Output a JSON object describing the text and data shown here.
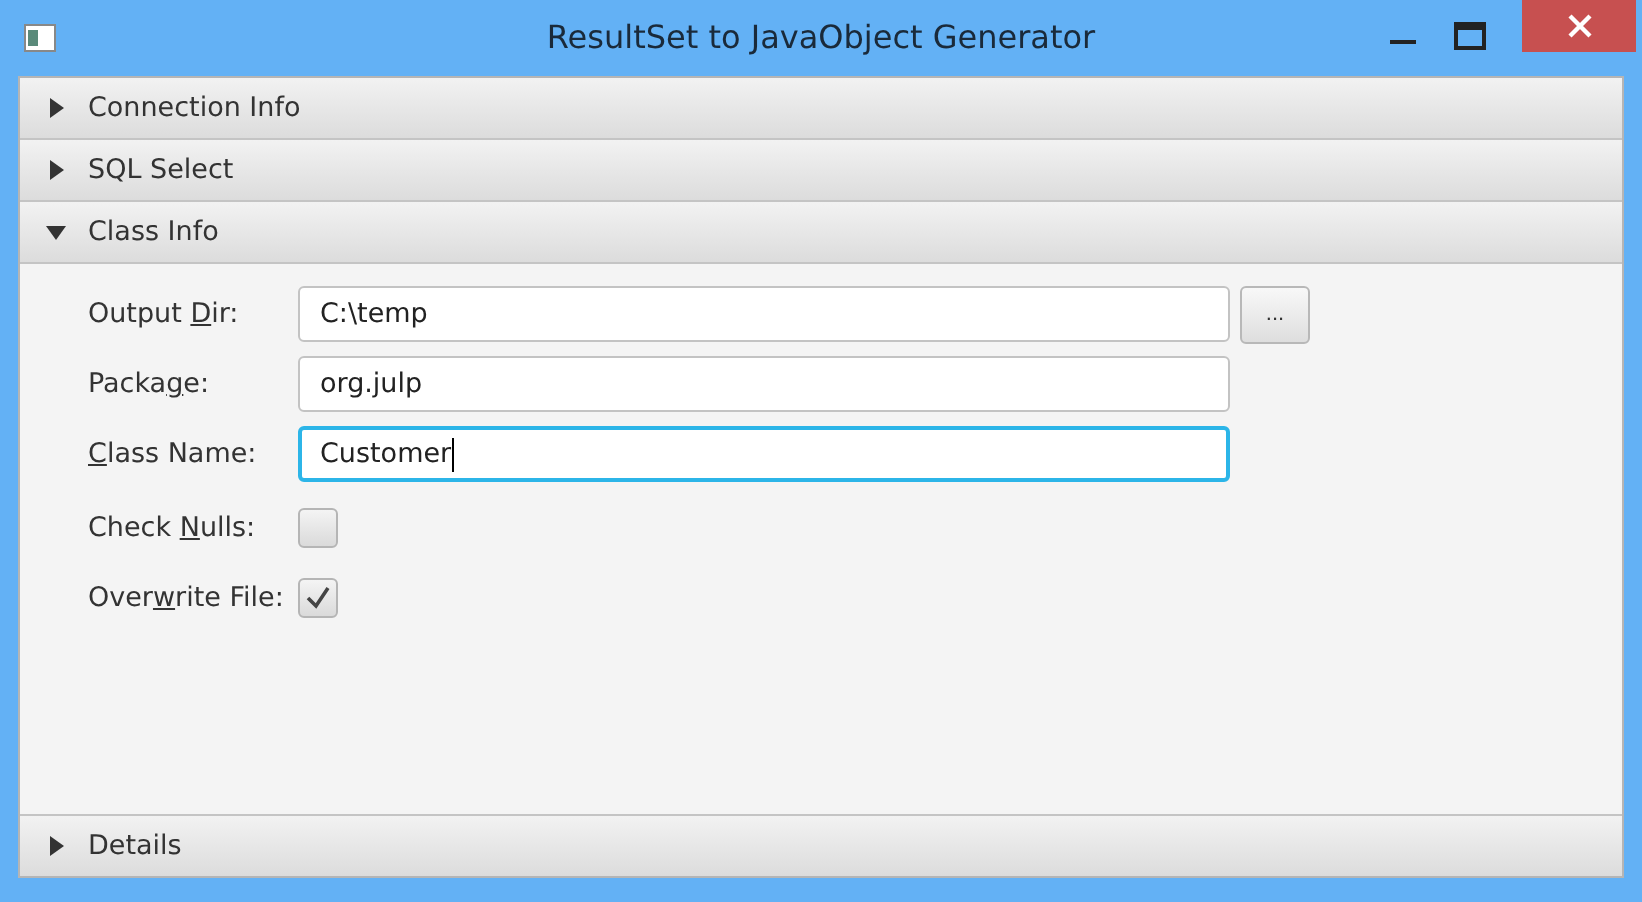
{
  "window": {
    "title": "ResultSet to JavaObject Generator"
  },
  "panes": [
    {
      "title": "Connection Info",
      "expanded": false
    },
    {
      "title": "SQL Select",
      "expanded": false
    },
    {
      "title": "Class Info",
      "expanded": true,
      "form": [
        {
          "kind": "text",
          "label": {
            "before": "Output ",
            "key": "D",
            "after": "ir:"
          },
          "value": "C:\\temp",
          "focused": false,
          "button": "..."
        },
        {
          "kind": "text",
          "label": {
            "before": "Packa",
            "key": "g",
            "after": "e:"
          },
          "value": "org.julp",
          "focused": false
        },
        {
          "kind": "text",
          "label": {
            "key": "C",
            "after": "lass Name:"
          },
          "value": "Customer",
          "focused": true
        },
        {
          "kind": "checkbox",
          "label": {
            "before": "Check ",
            "key": "N",
            "after": "ulls:"
          },
          "checked": false
        },
        {
          "kind": "checkbox",
          "label": {
            "before": "Over",
            "key": "w",
            "after": "rite File:"
          },
          "checked": true
        }
      ]
    },
    {
      "title": "Details",
      "expanded": false
    }
  ]
}
